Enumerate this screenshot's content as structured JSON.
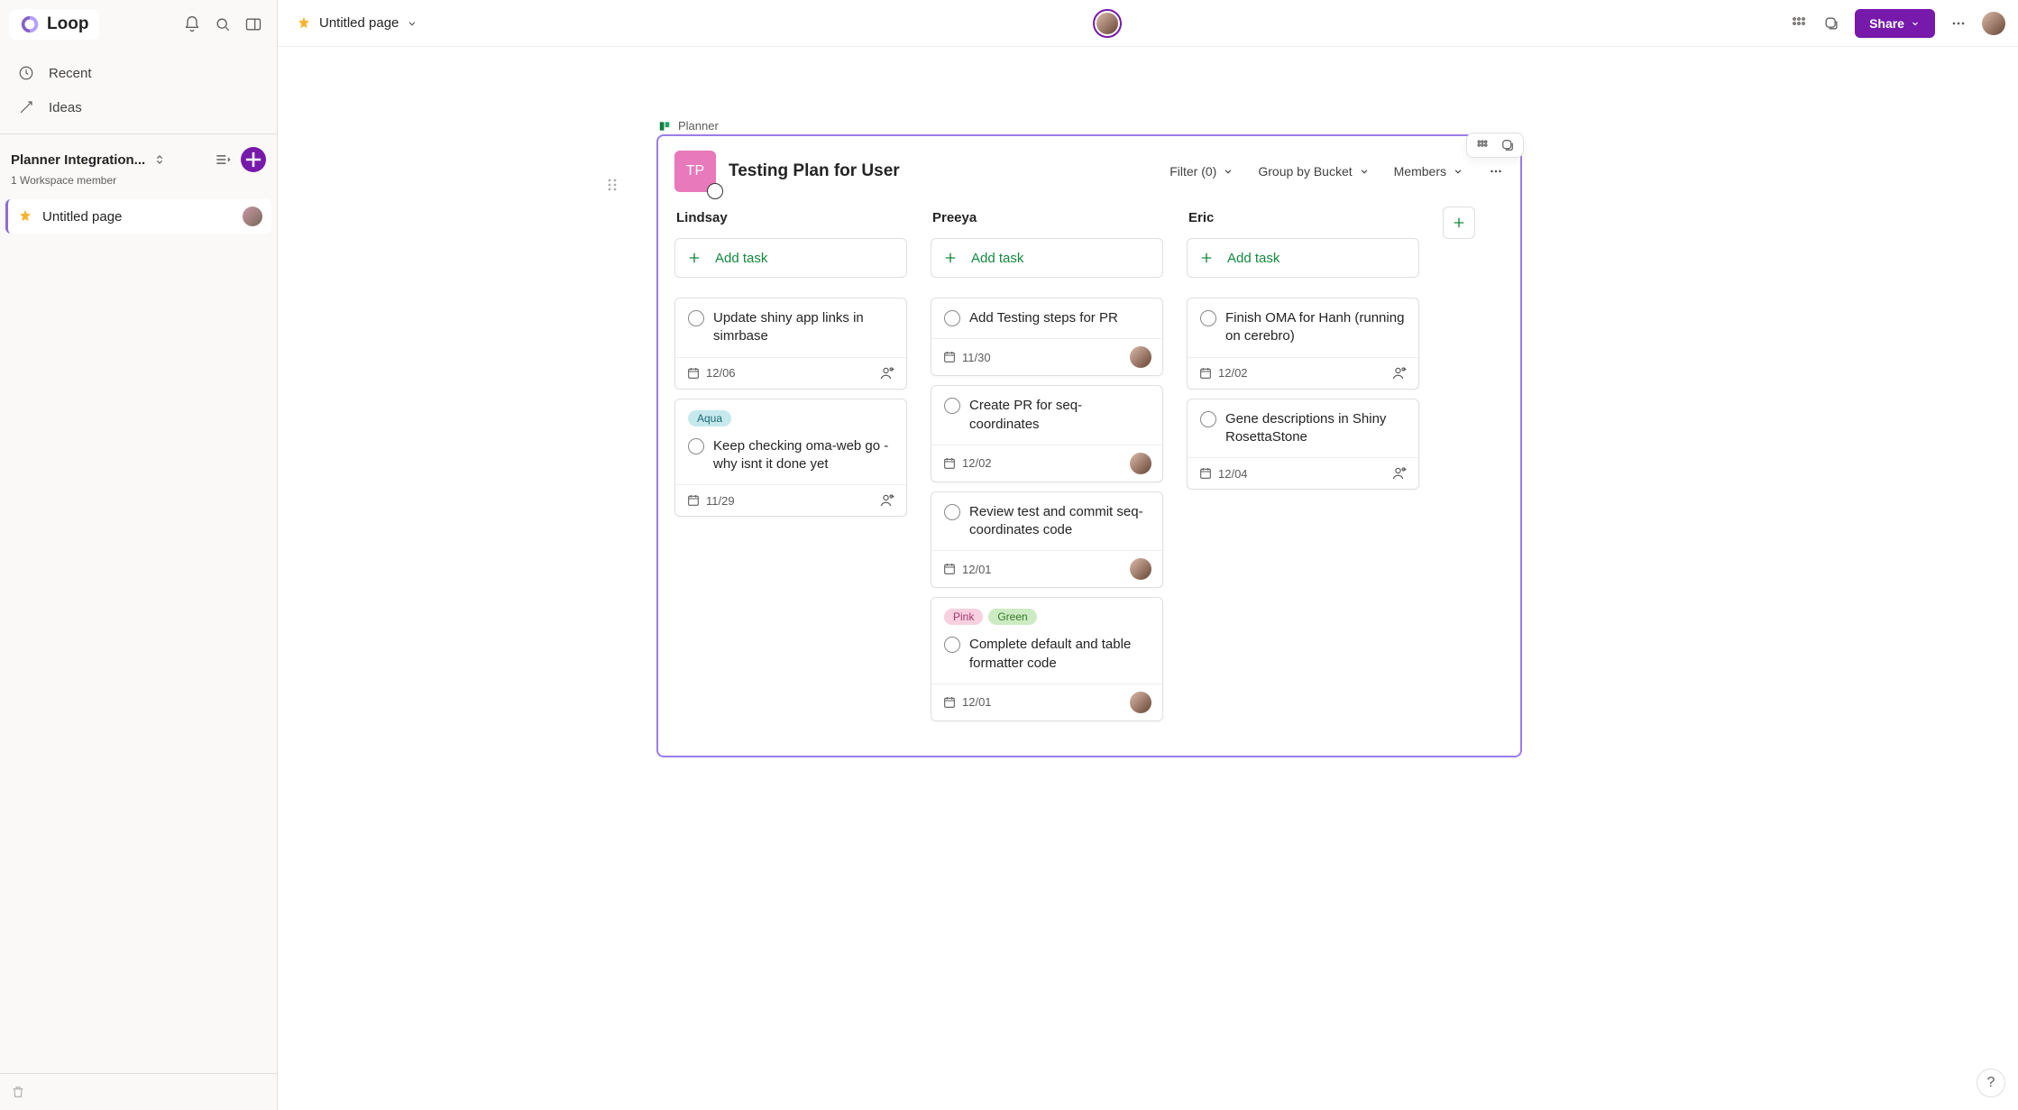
{
  "brand": {
    "name": "Loop"
  },
  "sidebar": {
    "nav": [
      {
        "icon": "clock-icon",
        "label": "Recent"
      },
      {
        "icon": "lightbulb-icon",
        "label": "Ideas"
      }
    ],
    "workspace": {
      "name": "Planner Integration...",
      "subtitle": "1 Workspace member"
    },
    "pages": [
      {
        "name": "Untitled page"
      }
    ]
  },
  "header": {
    "title": "Untitled page",
    "share": "Share"
  },
  "planner": {
    "chipLabel": "Planner",
    "tileInitials": "TP",
    "title": "Testing Plan for User",
    "controls": {
      "filter": "Filter (0)",
      "group": "Group by Bucket",
      "members": "Members"
    },
    "addTaskLabel": "Add task",
    "buckets": [
      {
        "name": "Lindsay",
        "tasks": [
          {
            "title": "Update shiny app links in simrbase",
            "due": "12/06",
            "avatar": false,
            "assignIcon": true,
            "tags": []
          },
          {
            "title": "Keep checking oma-web go - why isnt it done yet",
            "due": "11/29",
            "avatar": false,
            "assignIcon": true,
            "tags": [
              {
                "name": "Aqua",
                "cls": "aqua"
              }
            ]
          }
        ]
      },
      {
        "name": "Preeya",
        "tasks": [
          {
            "title": "Add Testing steps for PR",
            "due": "11/30",
            "avatar": true,
            "assignIcon": false,
            "tags": []
          },
          {
            "title": "Create PR for seq-coordinates",
            "due": "12/02",
            "avatar": true,
            "assignIcon": false,
            "tags": []
          },
          {
            "title": "Review test and commit seq-coordinates code",
            "due": "12/01",
            "avatar": true,
            "assignIcon": false,
            "tags": []
          },
          {
            "title": "Complete default and table formatter code",
            "due": "12/01",
            "avatar": true,
            "assignIcon": false,
            "tags": [
              {
                "name": "Pink",
                "cls": "pink"
              },
              {
                "name": "Green",
                "cls": "green"
              }
            ]
          }
        ]
      },
      {
        "name": "Eric",
        "tasks": [
          {
            "title": "Finish OMA for Hanh (running on cerebro)",
            "due": "12/02",
            "avatar": false,
            "assignIcon": true,
            "tags": []
          },
          {
            "title": "Gene descriptions in Shiny RosettaStone",
            "due": "12/04",
            "avatar": false,
            "assignIcon": true,
            "tags": []
          }
        ]
      }
    ]
  }
}
